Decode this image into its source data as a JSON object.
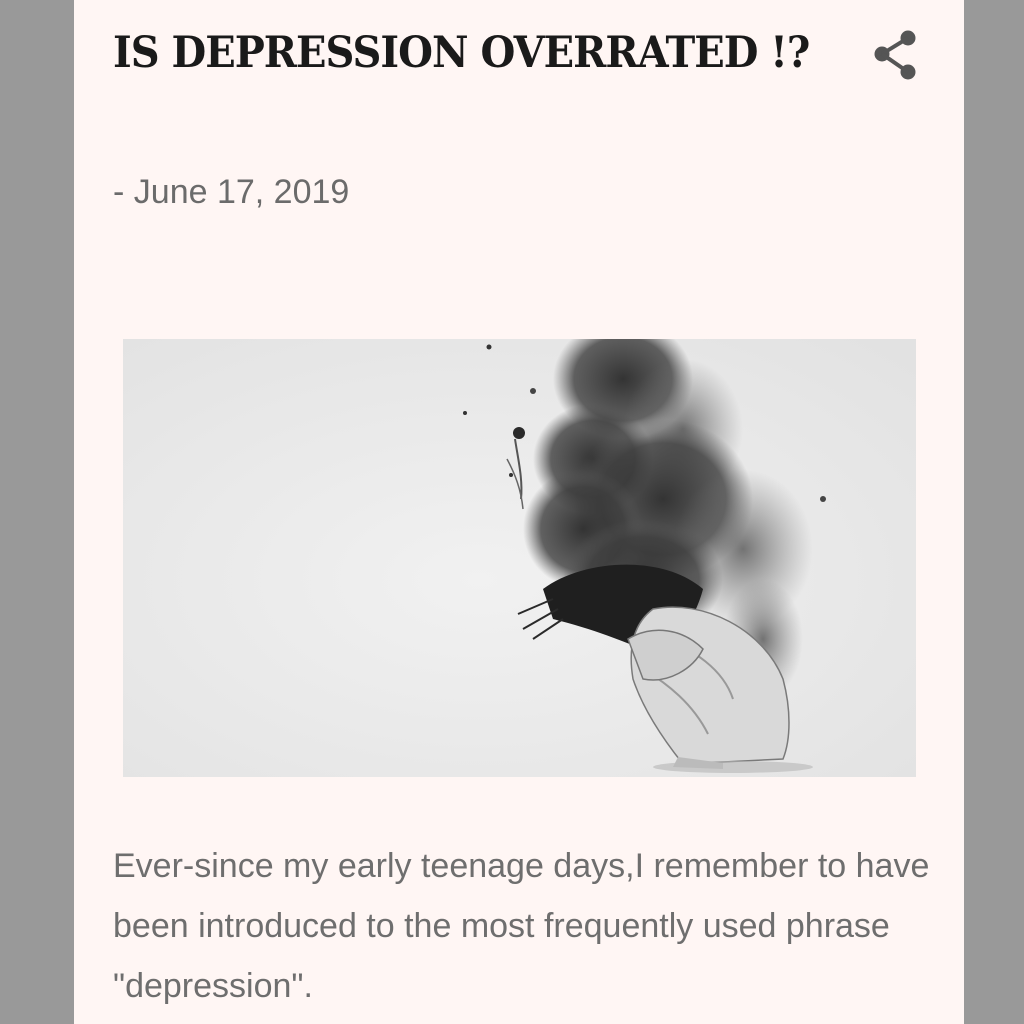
{
  "post": {
    "title": "IS DEPRESSION OVERRATED !?",
    "date_prefix": "-",
    "date": "June 17, 2019",
    "body": "Ever-since my early teenage days,I remember to have been introduced to the most frequently used phrase \"depression\"."
  },
  "toolbar": {
    "share_icon": "share-icon"
  },
  "colors": {
    "background_outer": "#999999",
    "page_background": "#fff6f4",
    "title_color": "#1a1a1a",
    "meta_color": "#6b6b6b",
    "body_color": "#6e6e6e"
  }
}
